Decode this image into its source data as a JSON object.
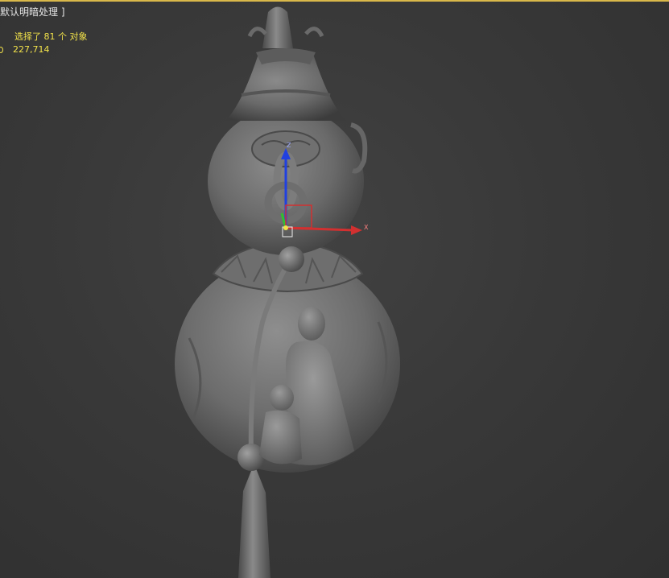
{
  "viewport": {
    "label": "默认明暗处理 ]",
    "selection_text": "选择了 81 个 对象",
    "count_value": "227,714",
    "gizmo_axis_z": "Z",
    "gizmo_axis_x": "X",
    "colors": {
      "background": "#3a3a3a",
      "accent_border": "#d9b84a",
      "stats_text": "#f2e24a",
      "axis_x": "#d23030",
      "axis_y": "#30c030",
      "axis_z": "#2040e0"
    }
  }
}
